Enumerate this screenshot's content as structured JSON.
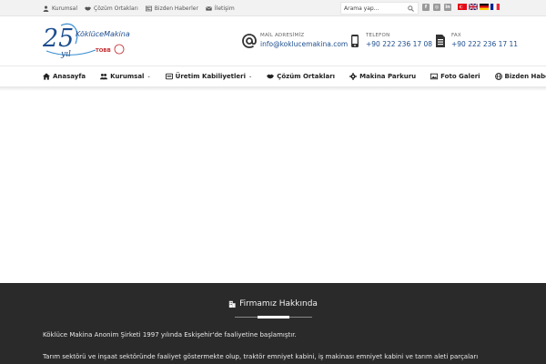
{
  "topbar": {
    "links": [
      {
        "label": "Kurumsal",
        "icon": "user-icon"
      },
      {
        "label": "Çözüm Ortakları",
        "icon": "handshake-icon"
      },
      {
        "label": "Bizden Haberler",
        "icon": "newspaper-icon"
      },
      {
        "label": "İletişim",
        "icon": "envelope-icon"
      }
    ],
    "search_placeholder": "Arama yap...",
    "social": [
      "facebook-icon",
      "instagram-icon",
      "linkedin-icon"
    ],
    "languages": [
      "tr",
      "en",
      "de",
      "fr"
    ]
  },
  "header": {
    "logo": {
      "brand": "KöklüceMakina",
      "badge_text": "TOBB",
      "anniversary": "25",
      "anniversary_word": "yıl"
    },
    "contacts": [
      {
        "label": "MAİL ADRESİMİZ",
        "value": "info@koklucemakina.com",
        "icon": "at-icon"
      },
      {
        "label": "TELEFON",
        "value": "+90 222 236 17 08",
        "icon": "phone-icon"
      },
      {
        "label": "FAX",
        "value": "+90 222 236 17 11",
        "icon": "fax-icon"
      }
    ]
  },
  "nav": {
    "items": [
      {
        "label": "Anasayfa",
        "icon": "home-icon",
        "has_dropdown": false
      },
      {
        "label": "Kurumsal",
        "icon": "users-icon",
        "has_dropdown": true
      },
      {
        "label": "Üretim Kabiliyetleri",
        "icon": "tools-icon",
        "has_dropdown": true
      },
      {
        "label": "Çözüm Ortakları",
        "icon": "handshake-icon",
        "has_dropdown": false
      },
      {
        "label": "Makina Parkuru",
        "icon": "gear-icon",
        "has_dropdown": false
      },
      {
        "label": "Foto Galeri",
        "icon": "image-icon",
        "has_dropdown": false
      },
      {
        "label": "Bizden Haberler",
        "icon": "globe-icon",
        "has_dropdown": false
      }
    ]
  },
  "footer": {
    "title": "Firmamız Hakkında",
    "paragraphs": [
      "Köklüce Makina Anonim Şirketi 1997 yılında Eskişehir'de faaliyetine başlamıştır.",
      "Tarım sektörü ve inşaat sektöründe faaliyet göstermekte olup, traktör emniyet kabini, iş makinası emniyet kabini ve tarım aleti parçaları"
    ]
  },
  "colors": {
    "accent": "#1d4e8f",
    "footer_bg": "#2a2a2a",
    "topbar_bg": "#f2f2f2"
  }
}
